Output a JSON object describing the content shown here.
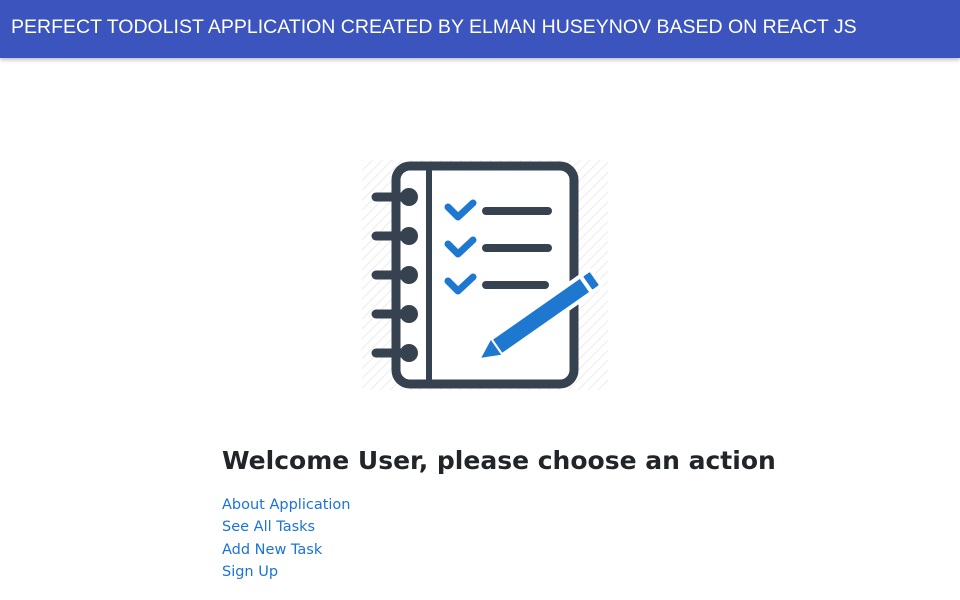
{
  "header": {
    "title": "PERFECT TODOLIST APPLICATION CREATED BY ELMAN HUSEYNOV BASED ON REACT JS",
    "background": "#3b54be"
  },
  "illustration": {
    "icon": "notebook-checklist-pencil-icon",
    "colors": {
      "dark": "#36424f",
      "accent": "#1f78cf"
    }
  },
  "main": {
    "heading": "Welcome User, please choose an action",
    "actions": [
      {
        "label": "About Application"
      },
      {
        "label": "See All Tasks"
      },
      {
        "label": "Add New Task"
      },
      {
        "label": "Sign Up"
      }
    ],
    "link_color": "#1a73d9"
  }
}
